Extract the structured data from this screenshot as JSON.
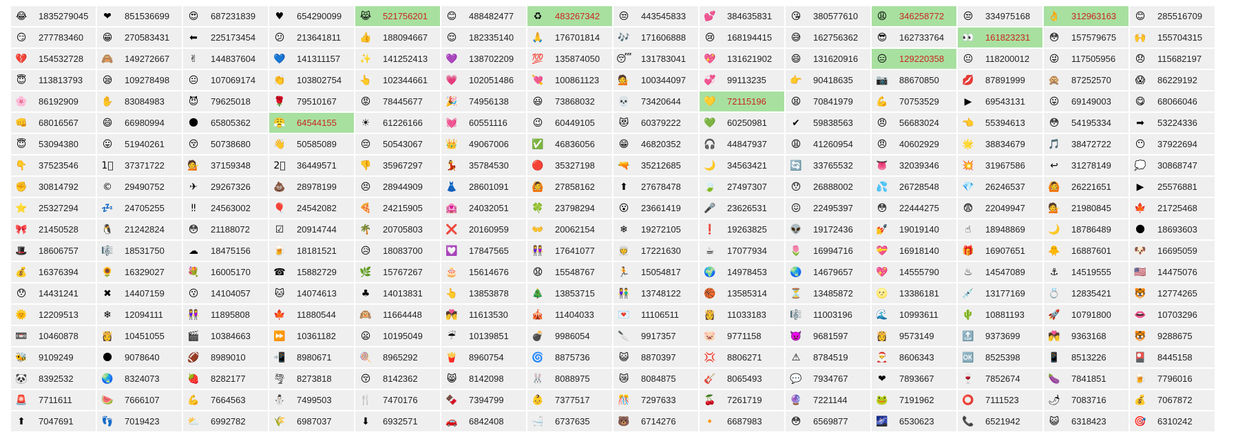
{
  "highlight_color": "#a8e0a0",
  "highlight_text_color": "#c8261f",
  "rows": [
    [
      {
        "e": "😂",
        "v": "1835279045"
      },
      {
        "e": "❤",
        "v": "851536699"
      },
      {
        "e": "😍",
        "v": "687231839"
      },
      {
        "e": "♥",
        "v": "654290099"
      },
      {
        "e": "😹",
        "v": "521756201",
        "h": true
      },
      {
        "e": "😊",
        "v": "488482477"
      },
      {
        "e": "♻",
        "v": "483267342",
        "h": true
      },
      {
        "e": "😒",
        "v": "443545833"
      },
      {
        "e": "💕",
        "v": "384635831"
      },
      {
        "e": "😘",
        "v": "380577610"
      },
      {
        "e": "😩",
        "v": "346258772",
        "h": true
      },
      {
        "e": "😒",
        "v": "334975168"
      },
      {
        "e": "👌",
        "v": "312963163",
        "h": true
      },
      {
        "e": "😊",
        "v": "285516709"
      }
    ],
    [
      {
        "e": "😏",
        "v": "277783460"
      },
      {
        "e": "😁",
        "v": "270583431"
      },
      {
        "e": "⬅",
        "v": "225173454"
      },
      {
        "e": "😕",
        "v": "213641811"
      },
      {
        "e": "👍",
        "v": "188094667"
      },
      {
        "e": "😌",
        "v": "182335140"
      },
      {
        "e": "🙏",
        "v": "176701814"
      },
      {
        "e": "🎶",
        "v": "171606888"
      },
      {
        "e": "😢",
        "v": "168194415"
      },
      {
        "e": "😅",
        "v": "162756362"
      },
      {
        "e": "😎",
        "v": "162733764"
      },
      {
        "e": "👀",
        "v": "161823231",
        "h": true
      },
      {
        "e": "😳",
        "v": "157579675"
      },
      {
        "e": "🙌",
        "v": "155704315"
      }
    ],
    [
      {
        "e": "💔",
        "v": "154532728"
      },
      {
        "e": "🙈",
        "v": "149272667"
      },
      {
        "e": "✌",
        "v": "144837604"
      },
      {
        "e": "💙",
        "v": "141311157"
      },
      {
        "e": "✨",
        "v": "141252413"
      },
      {
        "e": "💜",
        "v": "138702209"
      },
      {
        "e": "💯",
        "v": "135874050"
      },
      {
        "e": "😴",
        "v": "131783041"
      },
      {
        "e": "💖",
        "v": "131621902"
      },
      {
        "e": "😄",
        "v": "131620916"
      },
      {
        "e": "😑",
        "v": "129220358",
        "h": true
      },
      {
        "e": "😐",
        "v": "118200012"
      },
      {
        "e": "😜",
        "v": "117505956"
      },
      {
        "e": "😞",
        "v": "115682197"
      }
    ],
    [
      {
        "e": "😇",
        "v": "113813793"
      },
      {
        "e": "😪",
        "v": "109278498"
      },
      {
        "e": "😐",
        "v": "107069174"
      },
      {
        "e": "👏",
        "v": "103802754"
      },
      {
        "e": "👆",
        "v": "102344661"
      },
      {
        "e": "💗",
        "v": "102051486"
      },
      {
        "e": "💘",
        "v": "100861123"
      },
      {
        "e": "💁",
        "v": "100344097"
      },
      {
        "e": "💞",
        "v": "99113235"
      },
      {
        "e": "👉",
        "v": "90418635"
      },
      {
        "e": "📷",
        "v": "88670850"
      },
      {
        "e": "💋",
        "v": "87891999"
      },
      {
        "e": "🙊",
        "v": "87252570"
      },
      {
        "e": "😱",
        "v": "86229192"
      }
    ],
    [
      {
        "e": "🌸",
        "v": "86192909"
      },
      {
        "e": "✋",
        "v": "83084983"
      },
      {
        "e": "😈",
        "v": "79625018"
      },
      {
        "e": "🌹",
        "v": "79510167"
      },
      {
        "e": "😡",
        "v": "78445677"
      },
      {
        "e": "🎉",
        "v": "74956138"
      },
      {
        "e": "😃",
        "v": "73868032"
      },
      {
        "e": "💀",
        "v": "73420644"
      },
      {
        "e": "💛",
        "v": "72115196",
        "h": true
      },
      {
        "e": "😫",
        "v": "70841979"
      },
      {
        "e": "💪",
        "v": "70753529"
      },
      {
        "e": "▶",
        "v": "69543131"
      },
      {
        "e": "😛",
        "v": "69149003"
      },
      {
        "e": "😋",
        "v": "68066046"
      }
    ],
    [
      {
        "e": "👊",
        "v": "68016567"
      },
      {
        "e": "😄",
        "v": "66980994"
      },
      {
        "e": "🌑",
        "v": "65805362"
      },
      {
        "e": "😤",
        "v": "64544155",
        "h": true
      },
      {
        "e": "☀",
        "v": "61226166"
      },
      {
        "e": "💓",
        "v": "60551116"
      },
      {
        "e": "😉",
        "v": "60449105"
      },
      {
        "e": "😻",
        "v": "60379222"
      },
      {
        "e": "💚",
        "v": "60250981"
      },
      {
        "e": "✔",
        "v": "59838563"
      },
      {
        "e": "😠",
        "v": "56683024"
      },
      {
        "e": "👈",
        "v": "55394613"
      },
      {
        "e": "😳",
        "v": "54195334"
      },
      {
        "e": "➡",
        "v": "53224336"
      }
    ],
    [
      {
        "e": "😇",
        "v": "53094380"
      },
      {
        "e": "😛",
        "v": "51940261"
      },
      {
        "e": "😚",
        "v": "50738680"
      },
      {
        "e": "👋",
        "v": "50585089"
      },
      {
        "e": "😔",
        "v": "50543067"
      },
      {
        "e": "👑",
        "v": "49067006"
      },
      {
        "e": "✅",
        "v": "46836056"
      },
      {
        "e": "😁",
        "v": "46820352"
      },
      {
        "e": "🎧",
        "v": "44847937"
      },
      {
        "e": "😩",
        "v": "41260954"
      },
      {
        "e": "😠",
        "v": "40602929"
      },
      {
        "e": "🌟",
        "v": "38834679"
      },
      {
        "e": "🎵",
        "v": "38472722"
      },
      {
        "e": "😶",
        "v": "37922694"
      }
    ],
    [
      {
        "e": "👇",
        "v": "37523546"
      },
      {
        "e": "1⃣",
        "v": "37371722"
      },
      {
        "e": "💁",
        "v": "37159348"
      },
      {
        "e": "2⃣",
        "v": "36449571"
      },
      {
        "e": "👎",
        "v": "35967297"
      },
      {
        "e": "💃",
        "v": "35784530"
      },
      {
        "e": "🔴",
        "v": "35327198"
      },
      {
        "e": "🔫",
        "v": "35212685"
      },
      {
        "e": "🌙",
        "v": "34563421"
      },
      {
        "e": "🔄",
        "v": "33765532"
      },
      {
        "e": "👅",
        "v": "32039346"
      },
      {
        "e": "💥",
        "v": "31967586"
      },
      {
        "e": "↩",
        "v": "31278149"
      },
      {
        "e": "💭",
        "v": "30868747"
      }
    ],
    [
      {
        "e": "✊",
        "v": "30814792"
      },
      {
        "e": "©",
        "v": "29490752"
      },
      {
        "e": "✈",
        "v": "29267326"
      },
      {
        "e": "💩",
        "v": "28978199"
      },
      {
        "e": "😣",
        "v": "28944909"
      },
      {
        "e": "👗",
        "v": "28601091"
      },
      {
        "e": "🙆",
        "v": "27858162"
      },
      {
        "e": "⬆",
        "v": "27678478"
      },
      {
        "e": "🍃",
        "v": "27497307"
      },
      {
        "e": "😯",
        "v": "26888002"
      },
      {
        "e": "💦",
        "v": "26728548"
      },
      {
        "e": "💎",
        "v": "26246537"
      },
      {
        "e": "🙆",
        "v": "26221651"
      },
      {
        "e": "▶",
        "v": "25576881"
      }
    ],
    [
      {
        "e": "⭐",
        "v": "25327294"
      },
      {
        "e": "💤",
        "v": "24705255"
      },
      {
        "e": "‼",
        "v": "24563002"
      },
      {
        "e": "🎈",
        "v": "24542082"
      },
      {
        "e": "🍕",
        "v": "24215905"
      },
      {
        "e": "🏩",
        "v": "24032051"
      },
      {
        "e": "🍀",
        "v": "23798294"
      },
      {
        "e": "😮",
        "v": "23661419"
      },
      {
        "e": "🎤",
        "v": "23626531"
      },
      {
        "e": "😖",
        "v": "22495397"
      },
      {
        "e": "😳",
        "v": "22444275"
      },
      {
        "e": "😨",
        "v": "22049947"
      },
      {
        "e": "💁",
        "v": "21980845"
      },
      {
        "e": "🍁",
        "v": "21725468"
      }
    ],
    [
      {
        "e": "🎀",
        "v": "21450528"
      },
      {
        "e": "🐧",
        "v": "21242824"
      },
      {
        "e": "😳",
        "v": "21188072"
      },
      {
        "e": "☑",
        "v": "20914744"
      },
      {
        "e": "🌴",
        "v": "20705803"
      },
      {
        "e": "❌",
        "v": "20160959"
      },
      {
        "e": "👐",
        "v": "20062154"
      },
      {
        "e": "❄",
        "v": "19272105"
      },
      {
        "e": "❗",
        "v": "19263825"
      },
      {
        "e": "👽",
        "v": "19172436"
      },
      {
        "e": "💅",
        "v": "19019140"
      },
      {
        "e": "☝",
        "v": "18948869"
      },
      {
        "e": "🌙",
        "v": "18786489"
      },
      {
        "e": "🌑",
        "v": "18693603"
      }
    ],
    [
      {
        "e": "🎩",
        "v": "18606757"
      },
      {
        "e": "🎼",
        "v": "18531750"
      },
      {
        "e": "☁",
        "v": "18475156"
      },
      {
        "e": "🍺",
        "v": "18181521"
      },
      {
        "e": "😥",
        "v": "18083700"
      },
      {
        "e": "💟",
        "v": "17847565"
      },
      {
        "e": "👭",
        "v": "17641077"
      },
      {
        "e": "👳",
        "v": "17221630"
      },
      {
        "e": "☕",
        "v": "17077934"
      },
      {
        "e": "🌷",
        "v": "16994716"
      },
      {
        "e": "💝",
        "v": "16918140"
      },
      {
        "e": "🎁",
        "v": "16907651"
      },
      {
        "e": "🐥",
        "v": "16887601"
      },
      {
        "e": "🐶",
        "v": "16695059"
      }
    ],
    [
      {
        "e": "💰",
        "v": "16376394"
      },
      {
        "e": "🌻",
        "v": "16329027"
      },
      {
        "e": "💐",
        "v": "16005170"
      },
      {
        "e": "☎",
        "v": "15882729"
      },
      {
        "e": "🌿",
        "v": "15767267"
      },
      {
        "e": "🎂",
        "v": "15614676"
      },
      {
        "e": "😧",
        "v": "15548767"
      },
      {
        "e": "🏃",
        "v": "15054817"
      },
      {
        "e": "🌍",
        "v": "14978453"
      },
      {
        "e": "🌏",
        "v": "14679657"
      },
      {
        "e": "💖",
        "v": "14555790"
      },
      {
        "e": "♨",
        "v": "14547089"
      },
      {
        "e": "⚓",
        "v": "14519555"
      },
      {
        "e": "🇺🇸",
        "v": "14475076"
      }
    ],
    [
      {
        "e": "😯",
        "v": "14431241"
      },
      {
        "e": "✖",
        "v": "14407159"
      },
      {
        "e": "😗",
        "v": "14104057"
      },
      {
        "e": "🐱",
        "v": "14074613"
      },
      {
        "e": "♣",
        "v": "14013831"
      },
      {
        "e": "👆",
        "v": "13853878"
      },
      {
        "e": "🎄",
        "v": "13853715"
      },
      {
        "e": "👫",
        "v": "13748122"
      },
      {
        "e": "🏀",
        "v": "13585314"
      },
      {
        "e": "⏳",
        "v": "13485872"
      },
      {
        "e": "🌝",
        "v": "13386181"
      },
      {
        "e": "💉",
        "v": "13177169"
      },
      {
        "e": "💍",
        "v": "12835421"
      },
      {
        "e": "🐯",
        "v": "12774265"
      }
    ],
    [
      {
        "e": "🌞",
        "v": "12209513"
      },
      {
        "e": "❄",
        "v": "12094111"
      },
      {
        "e": "👭",
        "v": "11895808"
      },
      {
        "e": "🍁",
        "v": "11880544"
      },
      {
        "e": "🙉",
        "v": "11664448"
      },
      {
        "e": "💏",
        "v": "11613530"
      },
      {
        "e": "🎪",
        "v": "11404033"
      },
      {
        "e": "💌",
        "v": "11106511"
      },
      {
        "e": "👸",
        "v": "11033183"
      },
      {
        "e": "🎼",
        "v": "11003196"
      },
      {
        "e": "🌊",
        "v": "10993611"
      },
      {
        "e": "🌵",
        "v": "10881193"
      },
      {
        "e": "🚀",
        "v": "10791800"
      },
      {
        "e": "👄",
        "v": "10703296"
      }
    ],
    [
      {
        "e": "📼",
        "v": "10460878"
      },
      {
        "e": "👸",
        "v": "10451055"
      },
      {
        "e": "🎬",
        "v": "10384663"
      },
      {
        "e": "⏩",
        "v": "10361182"
      },
      {
        "e": "😦",
        "v": "10195049"
      },
      {
        "e": "☔",
        "v": "10139851"
      },
      {
        "e": "💣",
        "v": "9986054"
      },
      {
        "e": "🔪",
        "v": "9917357"
      },
      {
        "e": "🐷",
        "v": "9771158"
      },
      {
        "e": "👿",
        "v": "9681597"
      },
      {
        "e": "👸",
        "v": "9573149"
      },
      {
        "e": "🔝",
        "v": "9373699"
      },
      {
        "e": "💏",
        "v": "9363168"
      },
      {
        "e": "🐯",
        "v": "9288675"
      }
    ],
    [
      {
        "e": "🐝",
        "v": "9109249"
      },
      {
        "e": "🌑",
        "v": "9078640"
      },
      {
        "e": "🏈",
        "v": "8989010"
      },
      {
        "e": "📲",
        "v": "8980671"
      },
      {
        "e": "🍭",
        "v": "8965292"
      },
      {
        "e": "🍟",
        "v": "8960754"
      },
      {
        "e": "🌀",
        "v": "8875736"
      },
      {
        "e": "😺",
        "v": "8870397"
      },
      {
        "e": "💢",
        "v": "8806271"
      },
      {
        "e": "⚠",
        "v": "8784519"
      },
      {
        "e": "🎅",
        "v": "8606343"
      },
      {
        "e": "🆗",
        "v": "8525398"
      },
      {
        "e": "📱",
        "v": "8513226"
      },
      {
        "e": "🎴",
        "v": "8445158"
      }
    ],
    [
      {
        "e": "🐼",
        "v": "8392532"
      },
      {
        "e": "🌏",
        "v": "8324073"
      },
      {
        "e": "🍓",
        "v": "8282177"
      },
      {
        "e": "🌪",
        "v": "8273818"
      },
      {
        "e": "😚",
        "v": "8142362"
      },
      {
        "e": "😸",
        "v": "8142098"
      },
      {
        "e": "🐰",
        "v": "8088975"
      },
      {
        "e": "😿",
        "v": "8084875"
      },
      {
        "e": "🎸",
        "v": "8065493"
      },
      {
        "e": "💬",
        "v": "7934767"
      },
      {
        "e": "❤",
        "v": "7893667"
      },
      {
        "e": "🍷",
        "v": "7852674"
      },
      {
        "e": "🍆",
        "v": "7841851"
      },
      {
        "e": "🍺",
        "v": "7796016"
      }
    ],
    [
      {
        "e": "🚨",
        "v": "7711611"
      },
      {
        "e": "🍉",
        "v": "7666107"
      },
      {
        "e": "💪",
        "v": "7664563"
      },
      {
        "e": "⛄",
        "v": "7499503"
      },
      {
        "e": "🍴",
        "v": "7470176"
      },
      {
        "e": "🍫",
        "v": "7394799"
      },
      {
        "e": "👶",
        "v": "7377517"
      },
      {
        "e": "🎊",
        "v": "7297633"
      },
      {
        "e": "🍒",
        "v": "7261719"
      },
      {
        "e": "🔮",
        "v": "7221144"
      },
      {
        "e": "🐸",
        "v": "7191962"
      },
      {
        "e": "⭕",
        "v": "7111523"
      },
      {
        "e": "🌶",
        "v": "7083716"
      },
      {
        "e": "💰",
        "v": "7067872"
      }
    ],
    [
      {
        "e": "⬆",
        "v": "7047691"
      },
      {
        "e": "👣",
        "v": "7019423"
      },
      {
        "e": "⛅",
        "v": "6992782"
      },
      {
        "e": "🌾",
        "v": "6987037"
      },
      {
        "e": "⬇",
        "v": "6932571"
      },
      {
        "e": "🚗",
        "v": "6842408"
      },
      {
        "e": "🛁",
        "v": "6737635"
      },
      {
        "e": "🐻",
        "v": "6714276"
      },
      {
        "e": "🔸",
        "v": "6687983"
      },
      {
        "e": "😳",
        "v": "6569877"
      },
      {
        "e": "🌌",
        "v": "6530623"
      },
      {
        "e": "📞",
        "v": "6521942"
      },
      {
        "e": "😺",
        "v": "6318423"
      },
      {
        "e": "🎯",
        "v": "6310242"
      }
    ]
  ]
}
